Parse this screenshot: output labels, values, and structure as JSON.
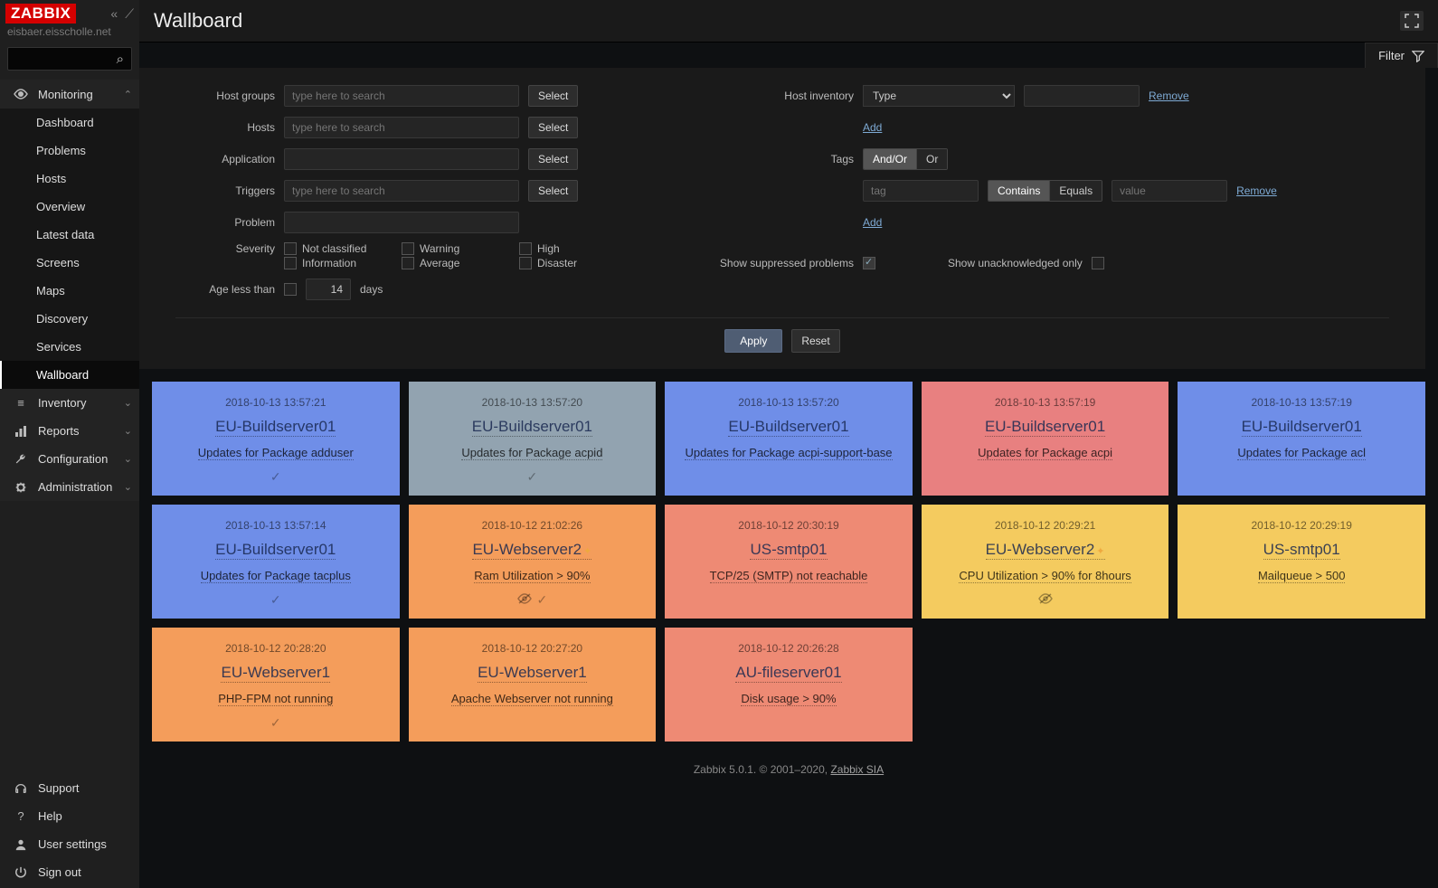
{
  "hostname": "eisbaer.eisscholle.net",
  "page_title": "Wallboard",
  "sidebar": {
    "menus": [
      {
        "icon": "eye",
        "label": "Monitoring",
        "expanded": true,
        "children": [
          {
            "label": "Dashboard"
          },
          {
            "label": "Problems"
          },
          {
            "label": "Hosts"
          },
          {
            "label": "Overview"
          },
          {
            "label": "Latest data"
          },
          {
            "label": "Screens"
          },
          {
            "label": "Maps"
          },
          {
            "label": "Discovery"
          },
          {
            "label": "Services"
          },
          {
            "label": "Wallboard",
            "active": true
          }
        ]
      },
      {
        "icon": "list",
        "label": "Inventory",
        "expanded": false
      },
      {
        "icon": "chart",
        "label": "Reports",
        "expanded": false
      },
      {
        "icon": "wrench",
        "label": "Configuration",
        "expanded": false
      },
      {
        "icon": "gear",
        "label": "Administration",
        "expanded": false
      }
    ],
    "bottom": [
      {
        "icon": "headset",
        "label": "Support"
      },
      {
        "icon": "help",
        "label": "Help"
      },
      {
        "icon": "user",
        "label": "User settings"
      },
      {
        "icon": "power",
        "label": "Sign out"
      }
    ]
  },
  "filter": {
    "tab_label": "Filter",
    "labels": {
      "host_groups": "Host groups",
      "hosts": "Hosts",
      "application": "Application",
      "triggers": "Triggers",
      "problem": "Problem",
      "severity": "Severity",
      "age_less_than": "Age less than",
      "days": "days",
      "host_inventory": "Host inventory",
      "tags": "Tags",
      "show_suppressed": "Show suppressed problems",
      "show_unack": "Show unacknowledged only"
    },
    "placeholder": "type here to search",
    "tag_placeholder": "tag",
    "value_placeholder": "value",
    "select": "Select",
    "add": "Add",
    "remove": "Remove",
    "apply": "Apply",
    "reset": "Reset",
    "inventory_type": "Type",
    "age_value": "14",
    "severities": [
      "Not classified",
      "Warning",
      "High",
      "Information",
      "Average",
      "Disaster"
    ],
    "tag_modes": [
      "And/Or",
      "Or"
    ],
    "tag_ops": [
      "Contains",
      "Equals"
    ],
    "show_suppressed_checked": true,
    "show_unack_checked": false
  },
  "cards": [
    {
      "ts": "2018-10-13 13:57:21",
      "host": "EU-Buildserver01",
      "trigger": "Updates for Package adduser",
      "sev": "blue",
      "ack": true
    },
    {
      "ts": "2018-10-13 13:57:20",
      "host": "EU-Buildserver01",
      "trigger": "Updates for Package acpid",
      "sev": "gray",
      "ack": true
    },
    {
      "ts": "2018-10-13 13:57:20",
      "host": "EU-Buildserver01",
      "trigger": "Updates for Package acpi-support-base",
      "sev": "blue"
    },
    {
      "ts": "2018-10-13 13:57:19",
      "host": "EU-Buildserver01",
      "trigger": "Updates for Package acpi",
      "sev": "red"
    },
    {
      "ts": "2018-10-13 13:57:19",
      "host": "EU-Buildserver01",
      "trigger": "Updates for Package acl",
      "sev": "blue"
    },
    {
      "ts": "2018-10-13 13:57:14",
      "host": "EU-Buildserver01",
      "trigger": "Updates for Package tacplus",
      "sev": "blue",
      "ack": true
    },
    {
      "ts": "2018-10-12 21:02:26",
      "host": "EU-Webserver2",
      "trigger": "Ram Utilization > 90%",
      "sev": "orange",
      "maint": true,
      "suppressed": true,
      "ack": true
    },
    {
      "ts": "2018-10-12 20:30:19",
      "host": "US-smtp01",
      "trigger": "TCP/25 (SMTP) not reachable",
      "sev": "coral"
    },
    {
      "ts": "2018-10-12 20:29:21",
      "host": "EU-Webserver2",
      "trigger": "CPU Utilization > 90% for 8hours",
      "sev": "yellow",
      "maint": true,
      "suppressed": true
    },
    {
      "ts": "2018-10-12 20:29:19",
      "host": "US-smtp01",
      "trigger": "Mailqueue > 500",
      "sev": "yellow"
    },
    {
      "ts": "2018-10-12 20:28:20",
      "host": "EU-Webserver1",
      "trigger": "PHP-FPM not running",
      "sev": "orange",
      "ack": true
    },
    {
      "ts": "2018-10-12 20:27:20",
      "host": "EU-Webserver1",
      "trigger": "Apache Webserver not running",
      "sev": "orange"
    },
    {
      "ts": "2018-10-12 20:26:28",
      "host": "AU-fileserver01",
      "trigger": "Disk usage > 90%",
      "sev": "coral"
    }
  ],
  "footer": {
    "text": "Zabbix 5.0.1. © 2001–2020, ",
    "link": "Zabbix SIA"
  },
  "icons": {
    "eye": "◉",
    "list": "≣",
    "chart": "▍▎",
    "wrench": "🔧",
    "gear": "⚙",
    "headset": "🎧",
    "help": "?",
    "user": "👤",
    "power": "⏻",
    "search": "🔍",
    "filter": "⚗",
    "fullscreen": "⛶",
    "check": "✓",
    "eyeoff": "👁"
  }
}
